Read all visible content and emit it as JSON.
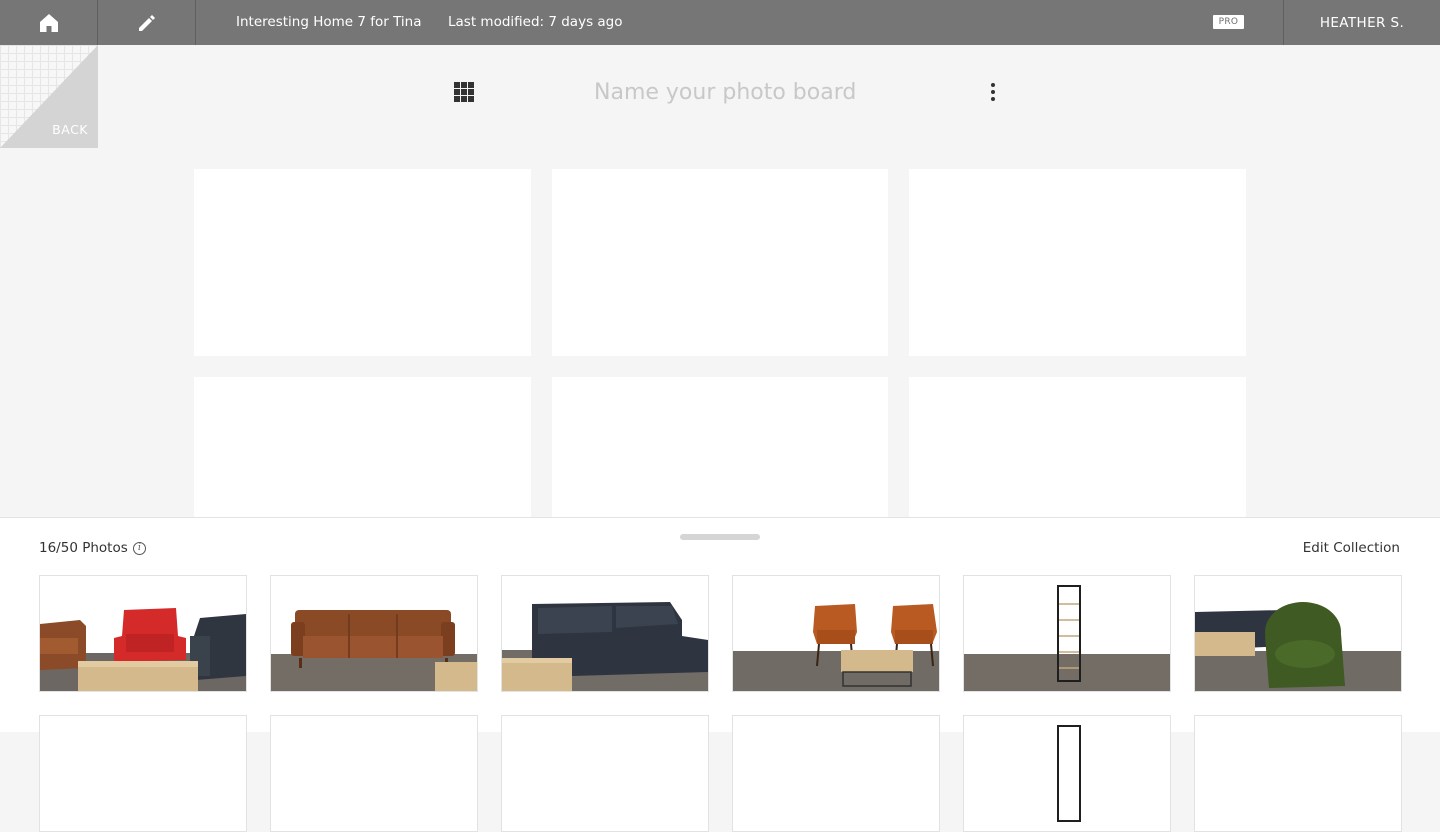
{
  "topbar": {
    "title": "Interesting Home 7 for Tina",
    "modified": "Last modified: 7 days ago",
    "pro_badge": "PRO",
    "user": "HEATHER S."
  },
  "back": {
    "label": "BACK"
  },
  "board": {
    "name_placeholder": "Name your photo board",
    "card_count": 6
  },
  "panel": {
    "photo_count": "16/50 Photos",
    "edit_label": "Edit Collection",
    "info_glyph": "i"
  },
  "photos": [
    {
      "name": "photo-red-armchair-scene"
    },
    {
      "name": "photo-brown-leather-sofa"
    },
    {
      "name": "photo-navy-chaise-sectional"
    },
    {
      "name": "photo-orange-wingback-chairs"
    },
    {
      "name": "photo-black-ladder-shelf"
    },
    {
      "name": "photo-green-swivel-chair"
    }
  ],
  "colors": {
    "topbar": "#767676",
    "background": "#f5f5f5",
    "red_chair": "#d42a2a",
    "leather": "#8a4a26",
    "navy": "#2f3640",
    "orange_leather": "#b85a22",
    "green_velvet": "#3f5a22",
    "wood_floor": "#757069",
    "oak_table": "#d2b88c"
  },
  "icons": {
    "home": "home-icon",
    "edit": "pencil-icon",
    "grid": "grid-icon",
    "menu": "kebab-menu-icon",
    "info": "info-icon"
  }
}
